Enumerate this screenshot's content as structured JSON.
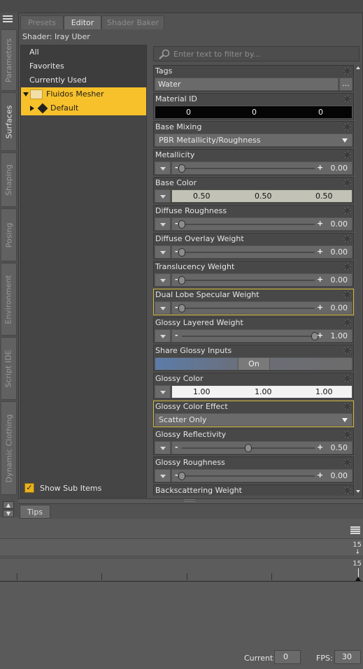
{
  "tabs_vertical": [
    "Parameters",
    "Surfaces",
    "Shaping",
    "Posing",
    "Environment",
    "Script IDE",
    "Dynamic Clothing"
  ],
  "tabs_horizontal": [
    "Presets",
    "Editor",
    "Shader Baker"
  ],
  "shader_label": "Shader: Iray Uber",
  "list": {
    "items": [
      "All",
      "Favorites",
      "Currently Used"
    ],
    "tree_root": "Fluidos Mesher",
    "tree_child": "Default",
    "show_sub_items": "Show Sub Items"
  },
  "filter": {
    "placeholder": "Enter text to filter by..."
  },
  "props": {
    "tags": {
      "label": "Tags",
      "value": "Water",
      "browse": "..."
    },
    "material_id": {
      "label": "Material ID",
      "values": [
        "0",
        "0",
        "0"
      ]
    },
    "base_mixing": {
      "label": "Base Mixing",
      "value": "PBR Metallicity/Roughness"
    },
    "metallicity": {
      "label": "Metallicity",
      "value": "0.00",
      "level": 0.0
    },
    "base_color": {
      "label": "Base Color",
      "values": [
        "0.50",
        "0.50",
        "0.50"
      ]
    },
    "diffuse_roughness": {
      "label": "Diffuse Roughness",
      "value": "0.00",
      "level": 0.0
    },
    "diffuse_overlay": {
      "label": "Diffuse Overlay Weight",
      "value": "0.00",
      "level": 0.0
    },
    "translucency": {
      "label": "Translucency Weight",
      "value": "0.00",
      "level": 0.0
    },
    "dual_lobe": {
      "label": "Dual Lobe Specular Weight",
      "value": "0.00",
      "level": 0.0
    },
    "glossy_layered": {
      "label": "Glossy Layered Weight",
      "value": "1.00",
      "level": 1.0
    },
    "share_glossy": {
      "label": "Share Glossy Inputs",
      "value": "On"
    },
    "glossy_color": {
      "label": "Glossy Color",
      "values": [
        "1.00",
        "1.00",
        "1.00"
      ]
    },
    "glossy_color_effect": {
      "label": "Glossy Color Effect",
      "value": "Scatter Only"
    },
    "glossy_reflectivity": {
      "label": "Glossy Reflectivity",
      "value": "0.50",
      "level": 0.5
    },
    "glossy_roughness": {
      "label": "Glossy Roughness",
      "value": "0.00",
      "level": 0.0
    },
    "backscattering": {
      "label": "Backscattering Weight"
    }
  },
  "tips_tab": "Tips",
  "timeline": {
    "end_frame_top": "15",
    "end_frame_bottom": "15",
    "current_label": "Current:",
    "current_value": "0",
    "fps_label": "FPS:",
    "fps_value": "30"
  }
}
